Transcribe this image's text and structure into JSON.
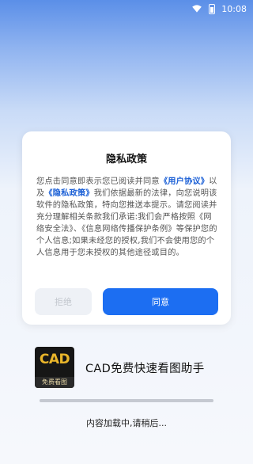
{
  "status_bar": {
    "time": "10:08",
    "icons": [
      "wifi-icon",
      "battery-icon"
    ]
  },
  "dialog": {
    "title": "隐私政策",
    "body_prefix": "您点击同意即表示您已阅读并同意",
    "link_user_agreement": "《用户协议》",
    "body_and": "以及",
    "link_privacy_policy": "《隐私政策》",
    "body_rest": "我们依据最新的法律，向您说明该软件的隐私政策，特向您推送本提示。请您阅读并充分理解相关条款我们承诺:我们会严格按照《网络安全法》、《信息网络传播保护条例》等保护您的个人信息;如果未经您的授权,我们不会使用您的个人信息用于您未授权的其他途径或目的。",
    "reject_label": "拒绝",
    "agree_label": "同意"
  },
  "app": {
    "logo_text": "CAD",
    "logo_subtext": "免费看图",
    "name": "CAD免费快速看图助手"
  },
  "loading": {
    "progress": 1.0,
    "text": "内容加载中,请稍后..."
  },
  "colors": {
    "accent": "#1c6ef2",
    "link": "#1a5fd6",
    "reject_bg": "#eef1f6",
    "logo_gold": "#e9b52a"
  }
}
